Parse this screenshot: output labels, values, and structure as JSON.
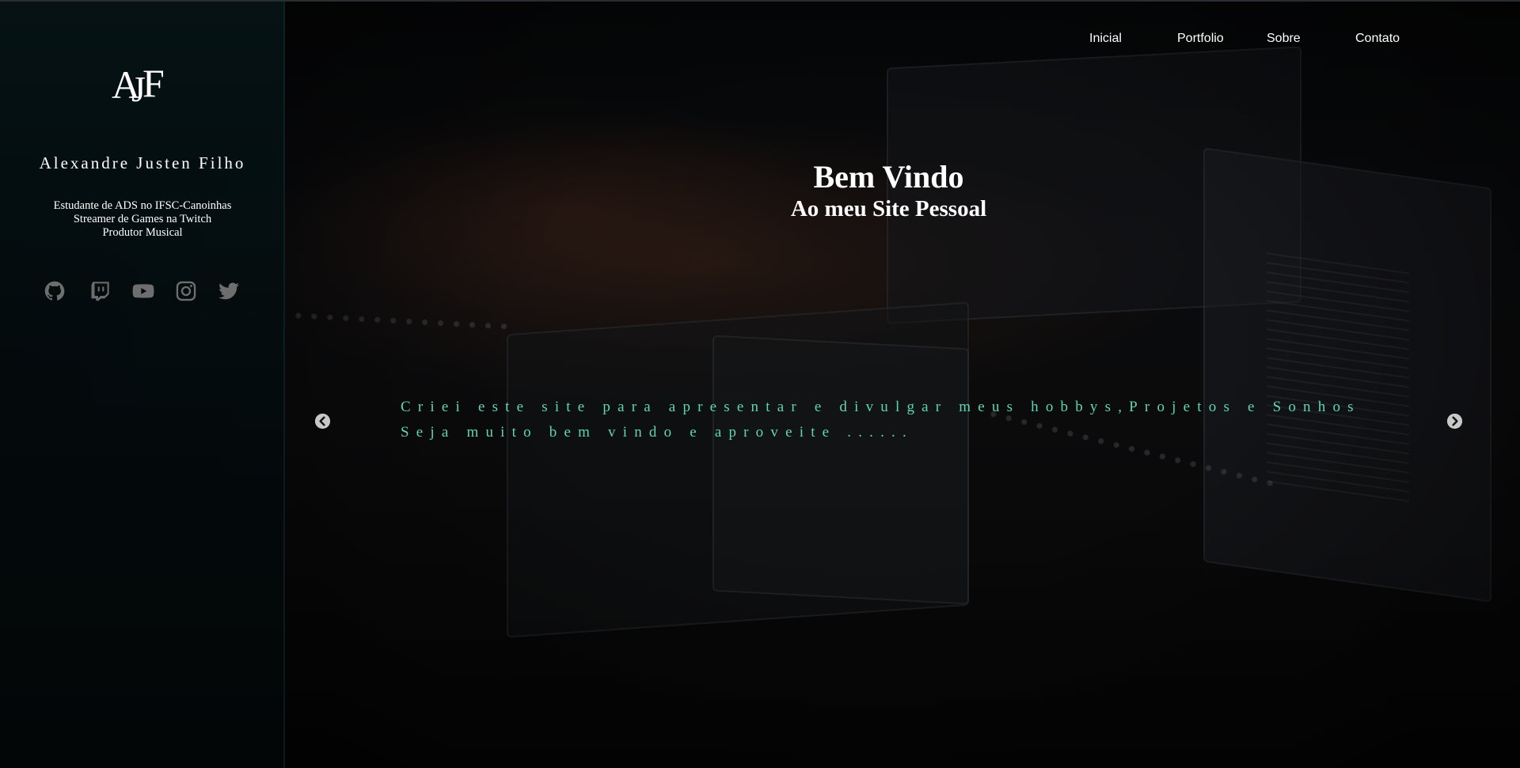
{
  "brand": {
    "logo_text": "AJF",
    "logo_letters": [
      "A",
      "J",
      "F"
    ],
    "name": "Alexandre Justen Filho"
  },
  "bio": {
    "lines": [
      "Estudante de ADS no IFSC-Canoinhas",
      "Streamer de Games na Twitch",
      "Produtor Musical"
    ]
  },
  "socials": [
    {
      "icon": "github-icon"
    },
    {
      "icon": "twitch-icon"
    },
    {
      "icon": "youtube-icon"
    },
    {
      "icon": "instagram-icon"
    },
    {
      "icon": "twitter-icon"
    }
  ],
  "nav": {
    "items": [
      {
        "label": "Inicial"
      },
      {
        "label": "Portfolio"
      },
      {
        "label": "Sobre"
      },
      {
        "label": "Contato"
      }
    ]
  },
  "hero": {
    "title": "Bem Vindo",
    "subtitle": "Ao meu Site Pessoal"
  },
  "carousel": {
    "lines": [
      "Criei este site para apresentar e divulgar meus hobbys,Projetos e Sonhos",
      "Seja muito bem vindo e aproveite ......"
    ],
    "prev_icon": "chevron-left-icon",
    "next_icon": "chevron-right-icon"
  },
  "colors": {
    "accent_text": "#5fd6b3",
    "icon_gray": "#6e6e6e",
    "background": "#050505"
  }
}
